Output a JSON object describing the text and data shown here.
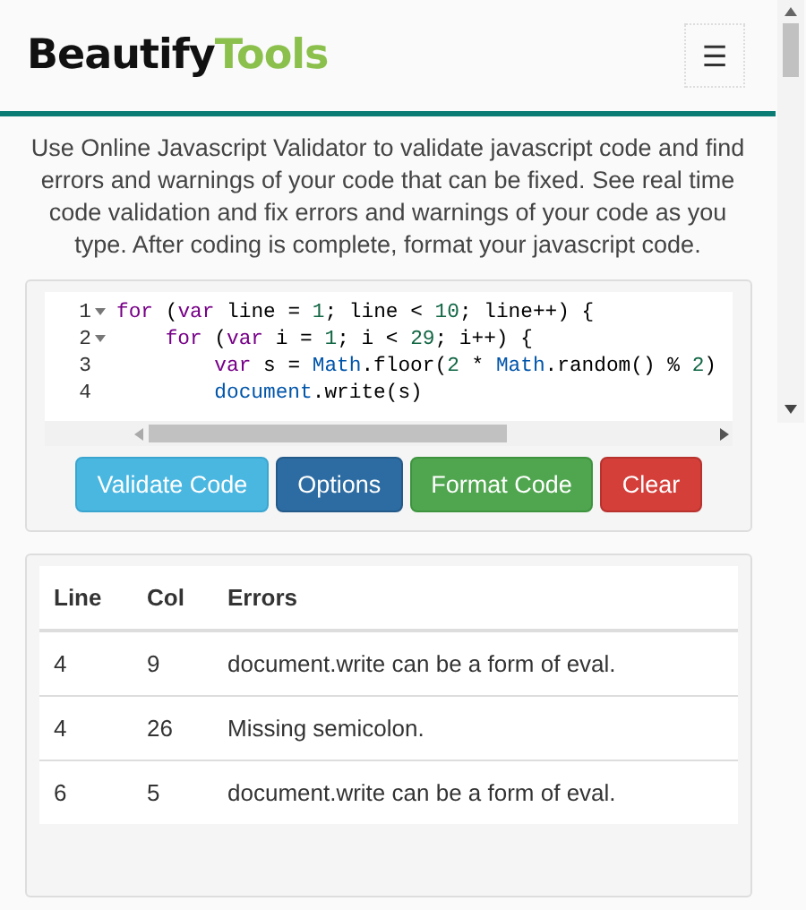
{
  "logo": {
    "part_1": "Beautify",
    "part_2": "Tools"
  },
  "menu_button": {
    "label": "☰"
  },
  "description": "Use Online Javascript Validator to validate javascript code and find errors and warnings of your code that can be fixed. See real time code validation and fix errors and warnings of your code as you type. After coding is complete, format your javascript code.",
  "editor": {
    "lines": [
      {
        "number": "1",
        "foldable": true,
        "tokens": [
          {
            "kind": "keyword",
            "text": "for"
          },
          {
            "kind": "plain",
            "text": " ("
          },
          {
            "kind": "keyword",
            "text": "var"
          },
          {
            "kind": "plain",
            "text": " line = "
          },
          {
            "kind": "number",
            "text": "1"
          },
          {
            "kind": "plain",
            "text": "; line < "
          },
          {
            "kind": "number",
            "text": "10"
          },
          {
            "kind": "plain",
            "text": "; line++) {"
          }
        ],
        "children": [
          {
            "number": "2",
            "foldable": true,
            "tokens": [
              {
                "kind": "keyword",
                "text": "for"
              },
              {
                "kind": "plain",
                "text": " ("
              },
              {
                "kind": "keyword",
                "text": "var"
              },
              {
                "kind": "plain",
                "text": " i = "
              },
              {
                "kind": "number",
                "text": "1"
              },
              {
                "kind": "plain",
                "text": "; i < "
              },
              {
                "kind": "number",
                "text": "29"
              },
              {
                "kind": "plain",
                "text": "; i++) {"
              }
            ],
            "children": [
              {
                "number": "3",
                "foldable": false,
                "tokens": [
                  {
                    "kind": "keyword",
                    "text": "var"
                  },
                  {
                    "kind": "plain",
                    "text": " s = "
                  },
                  {
                    "kind": "builtin",
                    "text": "Math"
                  },
                  {
                    "kind": "plain",
                    "text": ".floor("
                  },
                  {
                    "kind": "number",
                    "text": "2"
                  },
                  {
                    "kind": "plain",
                    "text": " * "
                  },
                  {
                    "kind": "builtin",
                    "text": "Math"
                  },
                  {
                    "kind": "plain",
                    "text": ".random() % "
                  },
                  {
                    "kind": "number",
                    "text": "2"
                  },
                  {
                    "kind": "plain",
                    "text": ")"
                  }
                ]
              },
              {
                "number": "4",
                "foldable": false,
                "tokens": [
                  {
                    "kind": "builtin",
                    "text": "document"
                  },
                  {
                    "kind": "plain",
                    "text": ".write(s)"
                  }
                ]
              }
            ]
          }
        ]
      }
    ]
  },
  "buttons": [
    {
      "label": "Validate Code",
      "kind": "info"
    },
    {
      "label": "Options",
      "kind": "primary"
    },
    {
      "label": "Format Code",
      "kind": "success"
    },
    {
      "label": "Clear",
      "kind": "danger"
    }
  ],
  "table": {
    "columns": [
      "Line",
      "Col",
      "Errors"
    ],
    "rows": [
      [
        "4",
        "9",
        "document.write can be a form of eval."
      ],
      [
        "4",
        "26",
        "Missing semicolon."
      ],
      [
        "6",
        "5",
        "document.write can be a form of eval."
      ]
    ]
  }
}
